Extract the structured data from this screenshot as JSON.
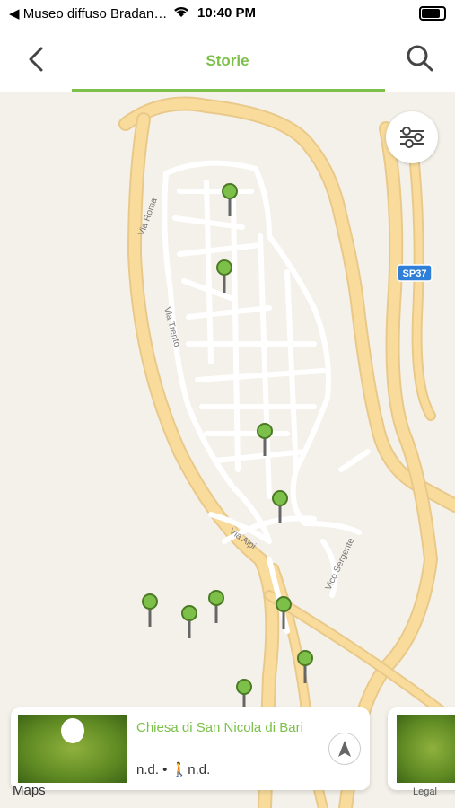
{
  "status_bar": {
    "back_app": "◀ Museo diffuso Bradan…",
    "time": "10:40 PM"
  },
  "header": {
    "title": "Storie"
  },
  "map": {
    "road_labels": [
      "Via Roma",
      "Via Trento",
      "Via Alpi",
      "Vico Sergente",
      "SP37"
    ]
  },
  "card": {
    "title": "Chiesa di San Nicola di Bari",
    "meta": "n.d. • 🚶n.d."
  },
  "attribution": {
    "maps": "Maps",
    "legal": "Legal"
  },
  "colors": {
    "accent": "#7cc04a",
    "road": "#f6d28b",
    "map_bg": "#f4f1ea"
  }
}
